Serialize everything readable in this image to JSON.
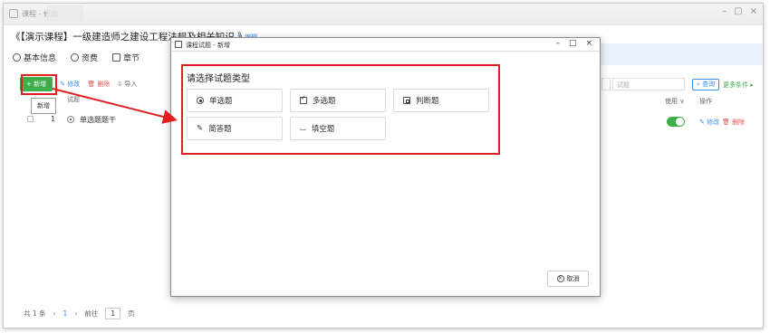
{
  "app": {
    "window_title": "课程 - 修改"
  },
  "header": {
    "course_title": "《【演示课程】一级建造师之建设工程法规及相关知识 》",
    "edit_label": "编辑"
  },
  "tabs": [
    {
      "label": "基本信息",
      "icon": "gear-icon"
    },
    {
      "label": "资费",
      "icon": "money-icon"
    },
    {
      "label": "章节",
      "icon": "chapter-icon"
    }
  ],
  "toolbar": {
    "add_label": "+ 新增",
    "edit_label": "修改",
    "delete_label": "删除",
    "import_label": "导入"
  },
  "tooltip": "新增",
  "table": {
    "columns": [
      "试题",
      "使用",
      "操作"
    ],
    "rows": [
      {
        "index": "1",
        "title": "单选题题干",
        "edit": "修改",
        "delete": "删除"
      }
    ]
  },
  "search": {
    "placeholder": "试题",
    "query_label": "查询",
    "more_label": "更多条件"
  },
  "footer": {
    "total": "共 1 条",
    "current_page": "1",
    "goto_prefix": "前往",
    "goto_value": "1",
    "goto_suffix": "页"
  },
  "modal": {
    "title": "课程试题 - 新增",
    "heading": "请选择试题类型",
    "types": [
      {
        "label": "单选题",
        "icon": "radio-icon"
      },
      {
        "label": "多选题",
        "icon": "checkbox-icon"
      },
      {
        "label": "判断题",
        "icon": "judge-icon"
      },
      {
        "label": "简答题",
        "icon": "edit-icon"
      },
      {
        "label": "填空题",
        "icon": "blank-icon"
      }
    ],
    "cancel_label": "取消"
  },
  "colors": {
    "accent_blue": "#3b8ee8",
    "green": "#3fae49",
    "red_annotation": "#e02020"
  }
}
